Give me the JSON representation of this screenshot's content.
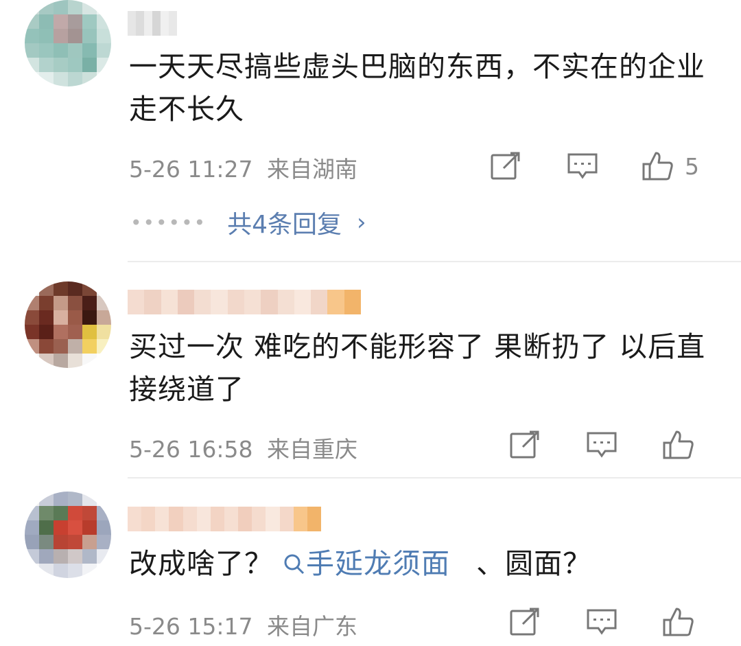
{
  "comments": [
    {
      "text": "一天天尽搞些虚头巴脑的东西，不实在的企业走不长久",
      "time": "5-26 11:27",
      "location": "来自湖南",
      "likes": "5",
      "replies_label": "共4条回复",
      "avatar_colors": [
        "#c9d9d6",
        "#a7c9c3",
        "#9ec5bf",
        "#b8d4ce",
        "#d7e5e2",
        "#eef4f3",
        "#a9cbc4",
        "#8dbcb4",
        "#c1a9a9",
        "#a89c9c",
        "#9fc9c1",
        "#cfe2de",
        "#94c2ba",
        "#8fbfb6",
        "#b7a1a0",
        "#a39392",
        "#98c4bc",
        "#c8dfda",
        "#a3c9c2",
        "#9ac6be",
        "#8fbfb6",
        "#9fc7bf",
        "#86bab1",
        "#bdd8d3",
        "#d2e4e0",
        "#b2d2cc",
        "#a7ccc4",
        "#9ec8c0",
        "#7ab0a6",
        "#dbe9e6",
        "#eef5f4",
        "#e3eeec",
        "#cfe2de",
        "#bcd7d2",
        "#cde0db",
        "#f2f7f6"
      ],
      "name_colors": [
        "#e6e6e6",
        "#dcdcdc",
        "#eeeeee",
        "#d6d6d6",
        "#f0f0f0",
        "#e8e8e8"
      ]
    },
    {
      "text": "买过一次 难吃的不能形容了 果断扔了 以后直接绕道了",
      "time": "5-26 16:58",
      "location": "来自重庆",
      "likes": "",
      "avatar_colors": [
        "#f0f0f0",
        "#9a6a5a",
        "#6e3a2a",
        "#5a2a20",
        "#7b4636",
        "#e8e8e8",
        "#b08070",
        "#7a3e2e",
        "#c49a88",
        "#8a5040",
        "#4a1e18",
        "#d8c8c0",
        "#8a4a3a",
        "#6a2a20",
        "#d8b0a0",
        "#9a5a48",
        "#3a1810",
        "#c8a898",
        "#7a3428",
        "#5a2018",
        "#b07060",
        "#a06050",
        "#e0c040",
        "#f0e0a0",
        "#c09080",
        "#8a4838",
        "#9a6050",
        "#c0b0a8",
        "#f2d060",
        "#f8f0c0",
        "#f4f4f4",
        "#d8c8c0",
        "#b8a8a0",
        "#e8e0d8",
        "#f8f8f8",
        "#ffffff"
      ],
      "name_colors": [
        "#f4dcd0",
        "#efd2c4",
        "#f6e2d6",
        "#eccbbd",
        "#f3ddd1",
        "#f7e6dc",
        "#f2d8cb",
        "#f5e0d4",
        "#eed0c2",
        "#f4dfd3",
        "#f9e8de",
        "#f1d6c8",
        "#f8c68a",
        "#f2b46a"
      ]
    },
    {
      "text_before": "改成啥了？",
      "topic": "手延龙须面",
      "text_after": "、圆面？",
      "time": "5-26 15:17",
      "location": "来自广东",
      "likes": "",
      "avatar_colors": [
        "#f2f2f2",
        "#c8ccd8",
        "#a8b0c4",
        "#b0b8c8",
        "#e4e6ec",
        "#fafafa",
        "#b8c0d0",
        "#6f8a6a",
        "#5a7a56",
        "#d04a3a",
        "#c04838",
        "#a8b0c4",
        "#a0aac0",
        "#4f6e4a",
        "#c84030",
        "#d85040",
        "#b83c2c",
        "#9ca6bc",
        "#98a2b8",
        "#7a8a80",
        "#b84434",
        "#c04838",
        "#c8a090",
        "#a8b0c4",
        "#c4cad8",
        "#a0a8bc",
        "#b8b0b0",
        "#d0c8c8",
        "#b0b8c8",
        "#e8eaf0",
        "#f8f8f8",
        "#e4e6ec",
        "#d0d4e0",
        "#dcdfe8",
        "#f2f3f6",
        "#ffffff"
      ],
      "name_colors": [
        "#f6ddd0",
        "#f4d6c6",
        "#f7e2d6",
        "#f2d0bf",
        "#f5dccf",
        "#f8e6dc",
        "#f3d4c4",
        "#f6dfd2",
        "#f1cebd",
        "#f5dcce",
        "#f9e9df",
        "#f4d8c9",
        "#f8c68a",
        "#f2b46a"
      ]
    }
  ],
  "icons": [
    "share-icon",
    "comment-icon",
    "like-icon"
  ],
  "colors": {
    "meta": "#8a8a8a",
    "link": "#4f7cb3",
    "divider": "#ececec"
  }
}
